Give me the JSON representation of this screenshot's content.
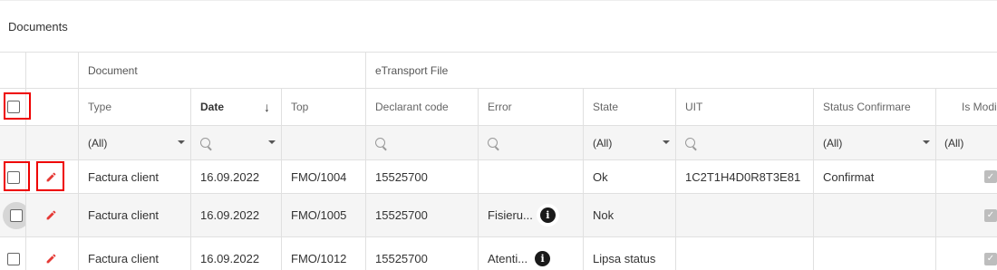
{
  "header": {
    "title": "Documents"
  },
  "bands": {
    "document": "Document",
    "etransport": "eTransport File"
  },
  "columns": {
    "type": "Type",
    "date": "Date",
    "top": "Top",
    "declarant": "Declarant code",
    "error": "Error",
    "state": "State",
    "uit": "UIT",
    "status": "Status Confirmare",
    "ismod": "Is Modi"
  },
  "sort": {
    "date_arrow": "↓"
  },
  "filters": {
    "type": "(All)",
    "state": "(All)",
    "status": "(All)",
    "ismod": "(All)"
  },
  "icons": {
    "info": "i",
    "check": "✓"
  },
  "colors": {
    "highlight": "#e00000",
    "edit": "#e53935"
  },
  "rows": [
    {
      "type": "Factura client",
      "date": "16.09.2022",
      "top": "FMO/1004",
      "declarant": "15525700",
      "error": "",
      "state": "Ok",
      "uit": "1C2T1H4D0R8T3E81",
      "status": "Confirmat"
    },
    {
      "type": "Factura client",
      "date": "16.09.2022",
      "top": "FMO/1005",
      "declarant": "15525700",
      "error": "Fisieru...",
      "state": "Nok",
      "uit": "",
      "status": ""
    },
    {
      "type": "Factura client",
      "date": "16.09.2022",
      "top": "FMO/1012",
      "declarant": "15525700",
      "error": "Atenti...",
      "state": "Lipsa status",
      "uit": "",
      "status": ""
    }
  ]
}
